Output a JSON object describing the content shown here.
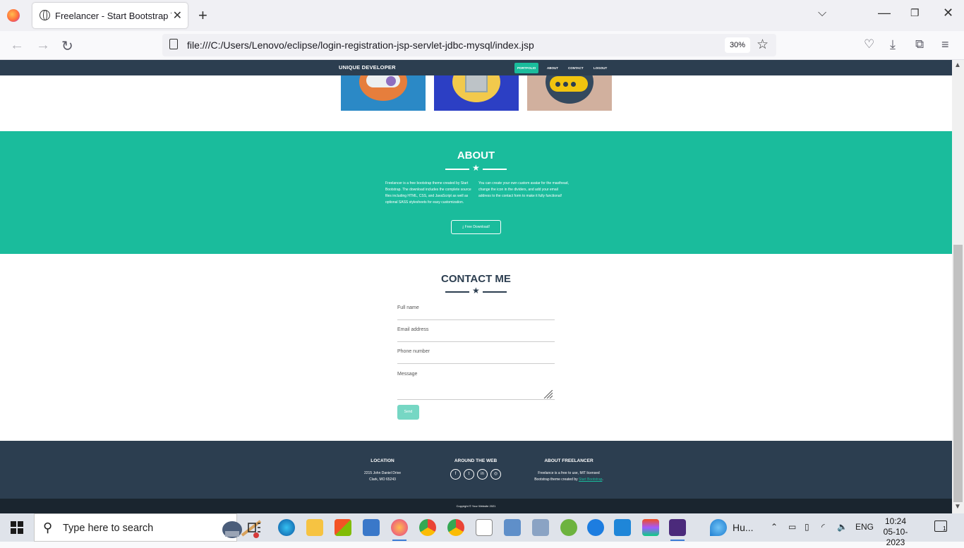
{
  "browser": {
    "tab_title": "Freelancer - Start Bootstrap The",
    "url": "file:///C:/Users/Lenovo/eclipse/login-registration-jsp-servlet-jdbc-mysql/index.jsp",
    "zoom": "30%"
  },
  "site": {
    "brand": "UNIQUE DEVELOPER",
    "nav": [
      "PORTFOLIO",
      "ABOUT",
      "CONTACT",
      "LOGOUT"
    ],
    "active_nav": "PORTFOLIO"
  },
  "about": {
    "title": "ABOUT",
    "col1": "Freelancer is a free bootstrap theme created by Start Bootstrap. The download includes the complete source files including HTML, CSS, and JavaScript as well as optional SASS stylesheets for easy customization.",
    "col2": "You can create your own custom avatar for the masthead, change the icon in the dividers, and add your email address to the contact form to make it fully functional!",
    "button": "Free Download!"
  },
  "contact": {
    "title": "CONTACT ME",
    "fields": {
      "name": "Full name",
      "email": "Email address",
      "phone": "Phone number",
      "message": "Message"
    },
    "send": "Send"
  },
  "footer": {
    "location_title": "LOCATION",
    "location_line1": "2215 John Daniel Drive",
    "location_line2": "Clark, MO 65243",
    "web_title": "AROUND THE WEB",
    "about_title": "ABOUT FREELANCER",
    "about_line1": "Freelance is a free to use, MIT licensed",
    "about_line2": "Bootstrap theme created by",
    "about_link": "Start Bootstrap",
    "copyright": "Copyright © Your Website 2021"
  },
  "taskbar": {
    "search_placeholder": "Type here to search",
    "weather": "Hu...",
    "language": "ENG",
    "time": "10:24",
    "date": "05-10-2023",
    "notifications": "1"
  },
  "colors": {
    "primary": "#1abc9c",
    "secondary": "#2c3e50"
  }
}
